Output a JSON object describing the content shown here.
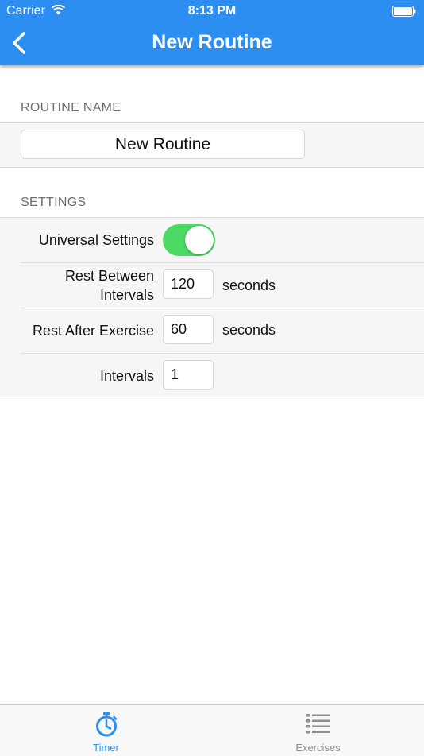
{
  "status_bar": {
    "carrier": "Carrier",
    "time": "8:13 PM"
  },
  "nav": {
    "title": "New Routine"
  },
  "routine_name": {
    "header": "ROUTINE NAME",
    "value": "New Routine"
  },
  "settings": {
    "header": "SETTINGS",
    "universal_label": "Universal Settings",
    "universal_on": true,
    "rest_between": {
      "label_line1": "Rest Between",
      "label_line2": "Intervals",
      "value": "120",
      "unit": "seconds"
    },
    "rest_after": {
      "label": "Rest After Exercise",
      "value": "60",
      "unit": "seconds"
    },
    "intervals": {
      "label": "Intervals",
      "value": "1"
    }
  },
  "tabs": [
    {
      "label": "Timer",
      "icon": "stopwatch-icon",
      "active": true
    },
    {
      "label": "Exercises",
      "icon": "list-icon",
      "active": false
    }
  ],
  "colors": {
    "accent": "#2b8ef0",
    "toggle_on": "#4cd964"
  }
}
